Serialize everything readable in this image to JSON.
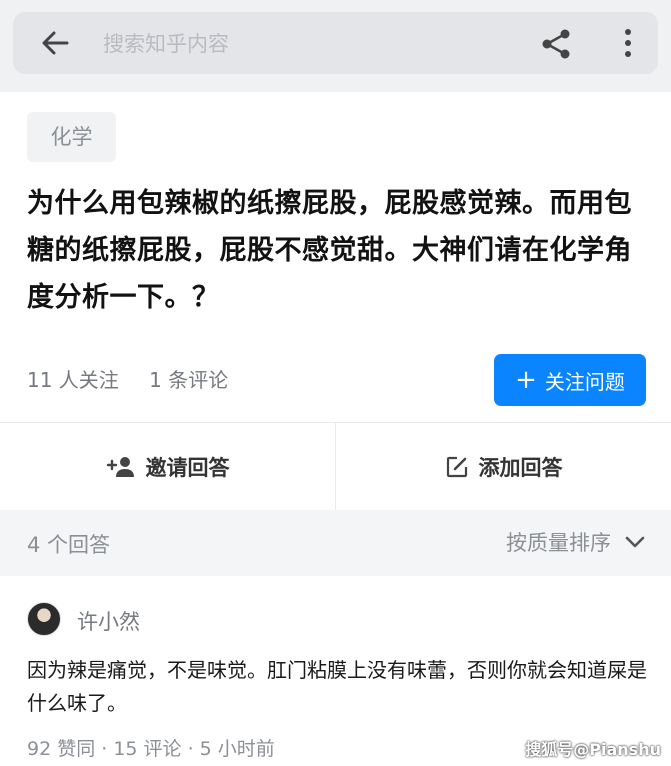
{
  "search": {
    "placeholder": "搜索知乎内容"
  },
  "question": {
    "topic": "化学",
    "title": "为什么用包辣椒的纸擦屁股，屁股感觉辣。而用包糖的纸擦屁股，屁股不感觉甜。大神们请在化学角度分析一下。？",
    "followers": "11 人关注",
    "comments": "1 条评论",
    "follow_button": "关注问题"
  },
  "actions": {
    "invite": "邀请回答",
    "add_answer": "添加回答"
  },
  "answers_header": {
    "count": "4 个回答",
    "sort": "按质量排序"
  },
  "answer": {
    "author": "许小然",
    "text": "因为辣是痛觉，不是味觉。肛门粘膜上没有味蕾，否则你就会知道屎是什么味了。",
    "meta": "92 赞同 · 15 评论 · 5 小时前"
  },
  "watermark": "搜狐号@Pianshu",
  "colors": {
    "accent": "#0a84ff",
    "muted_text": "#8b8f96"
  }
}
